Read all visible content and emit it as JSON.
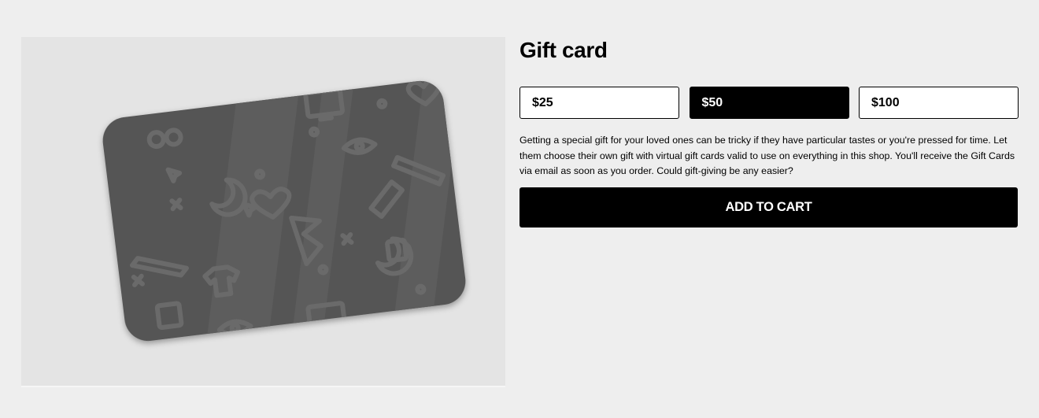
{
  "product": {
    "title": "Gift card",
    "image_alt": "Gift card illustration",
    "amounts": [
      {
        "label": "$25",
        "selected": false
      },
      {
        "label": "$50",
        "selected": true
      },
      {
        "label": "$100",
        "selected": false
      }
    ],
    "description": "Getting a special gift for your loved ones can be tricky if they have particular tastes or you're pressed for time. Let them choose their own gift with virtual gift cards valid to use on everything in this shop. You'll receive the Gift Cards via email as soon as you order. Could gift-giving be any easier?",
    "add_to_cart_label": "ADD TO CART"
  },
  "colors": {
    "page_background": "#eeeeee",
    "image_background": "#e4e4e4",
    "card": "#555555",
    "card_pattern": "#6a6a6a",
    "selected_button": "#000000"
  }
}
